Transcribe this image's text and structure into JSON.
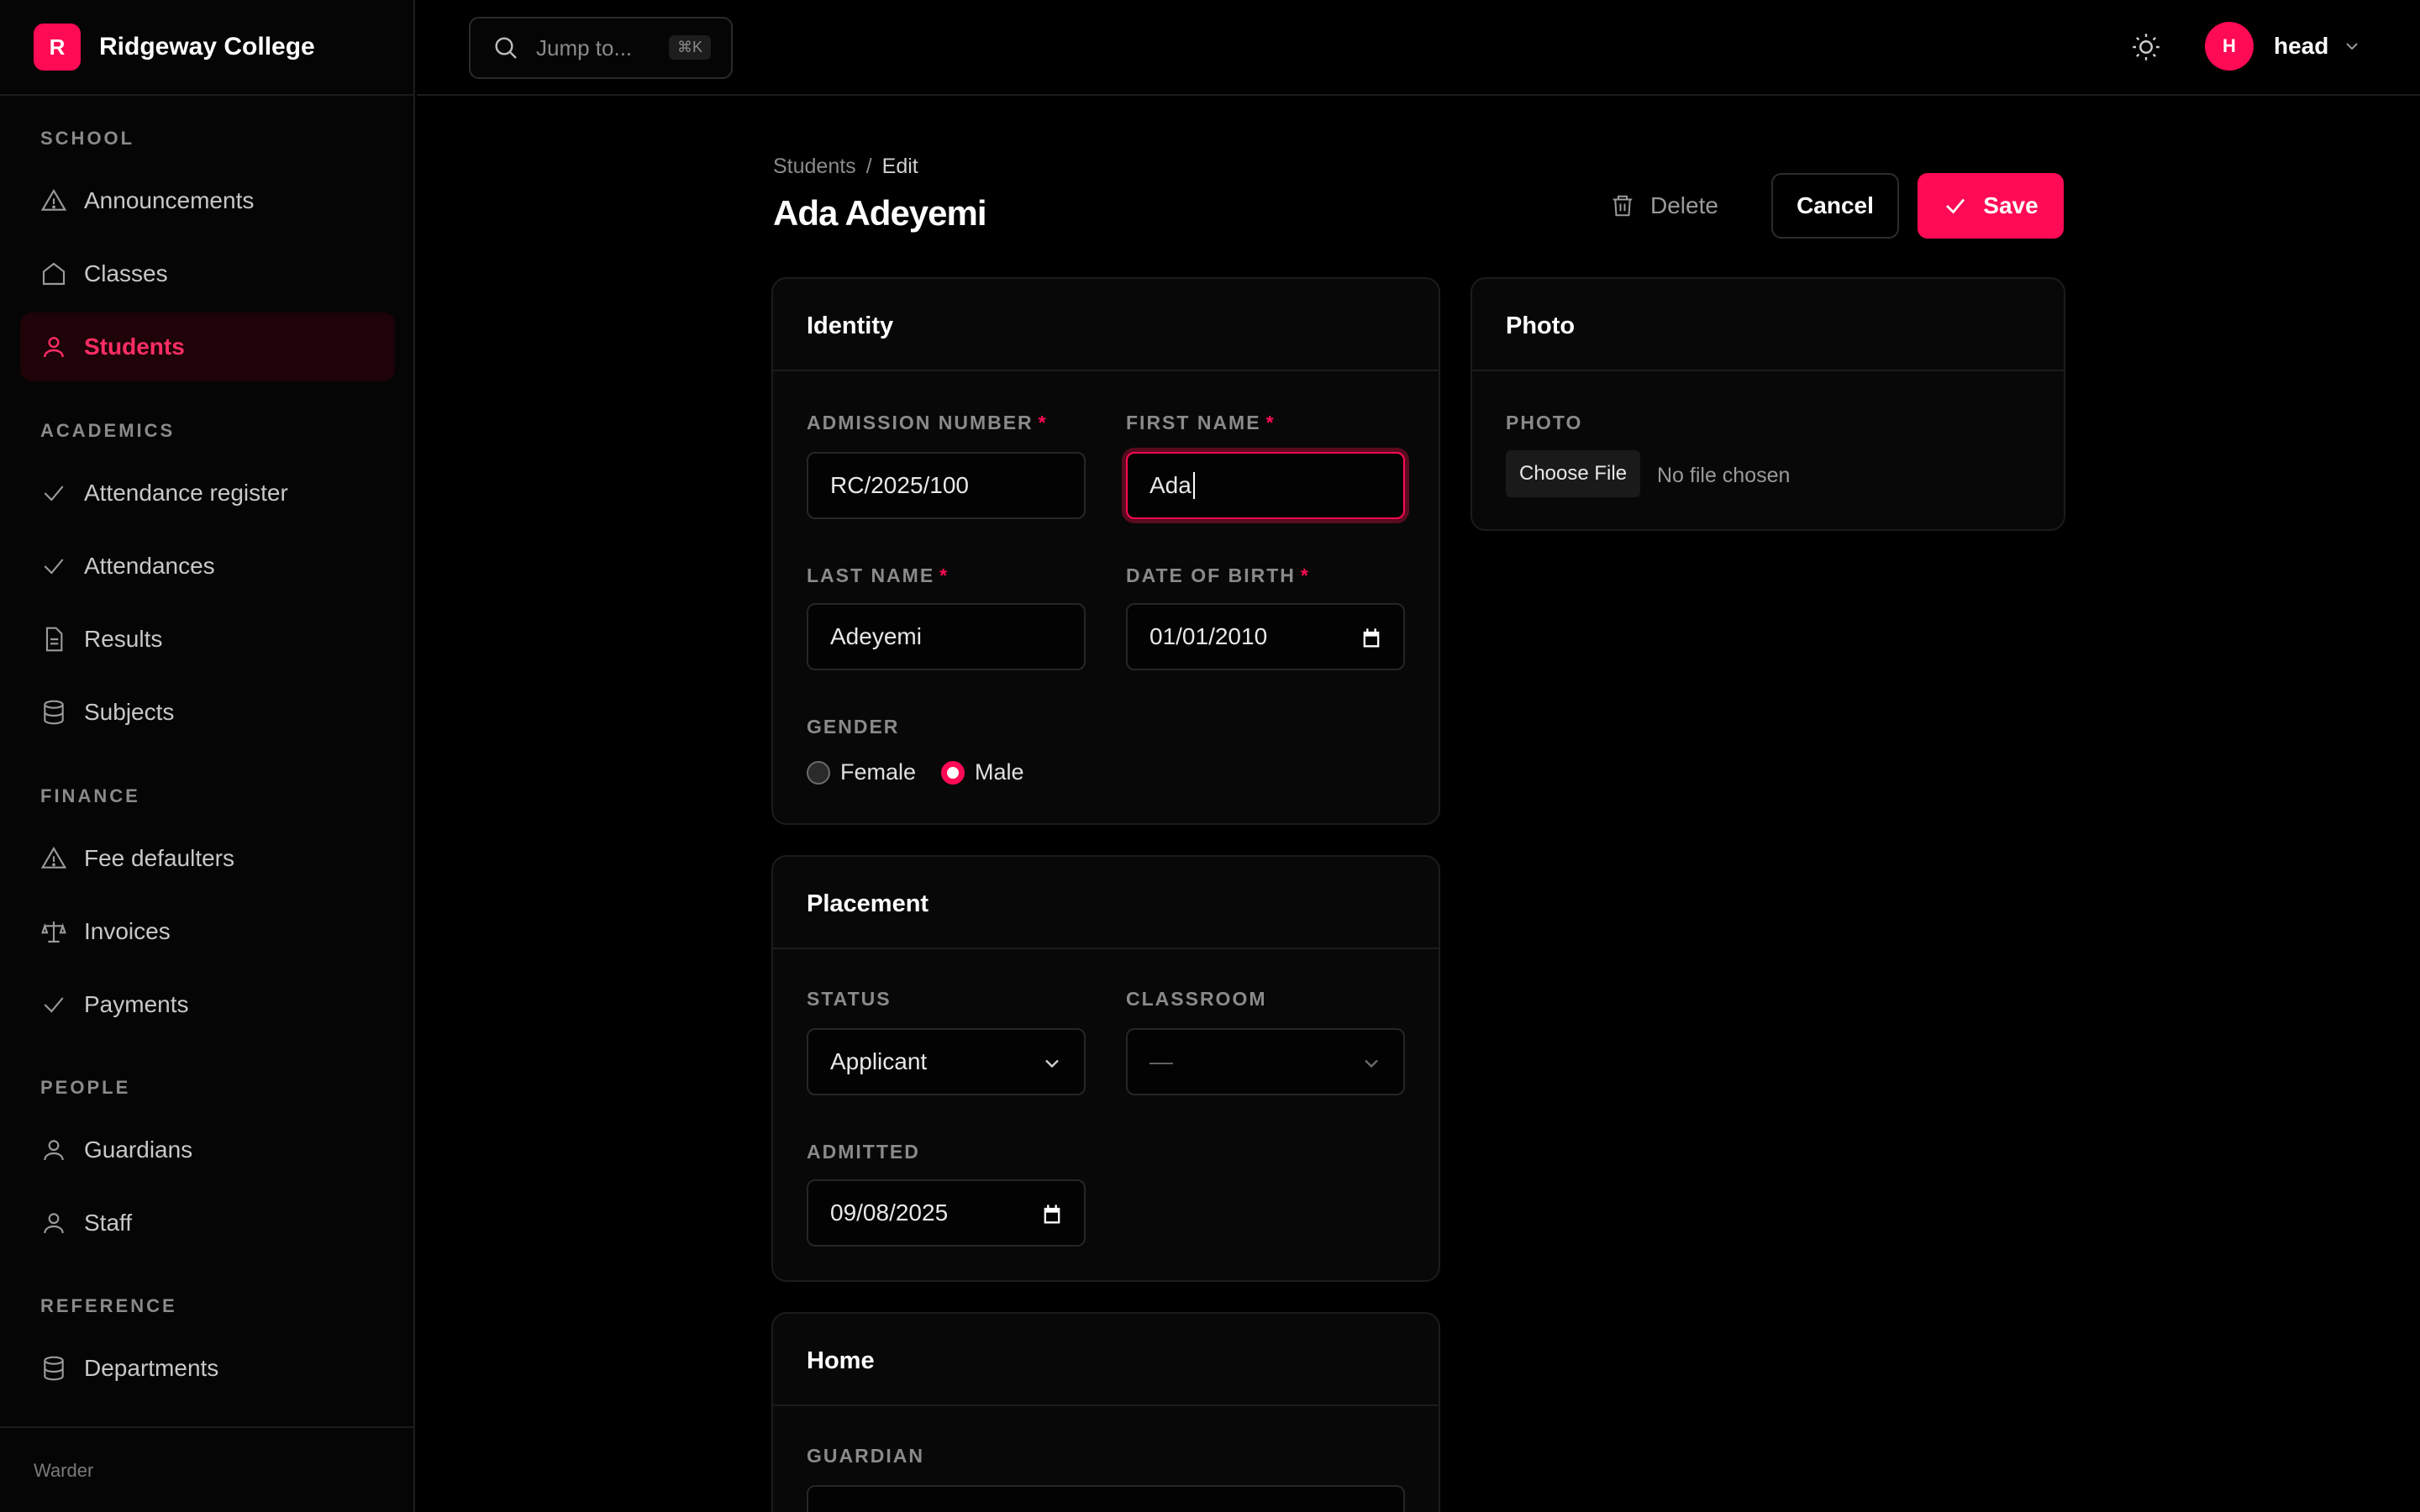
{
  "brand": {
    "logo_letter": "R",
    "name": "Ridgeway College"
  },
  "nav": {
    "sections": [
      {
        "label": "SCHOOL",
        "items": [
          {
            "label": "Announcements",
            "icon": "warning-icon"
          },
          {
            "label": "Classes",
            "icon": "home-icon"
          },
          {
            "label": "Students",
            "icon": "user-icon",
            "active": true
          }
        ]
      },
      {
        "label": "ACADEMICS",
        "items": [
          {
            "label": "Attendance register",
            "icon": "check-icon"
          },
          {
            "label": "Attendances",
            "icon": "check-icon"
          },
          {
            "label": "Results",
            "icon": "document-icon"
          },
          {
            "label": "Subjects",
            "icon": "database-icon"
          }
        ]
      },
      {
        "label": "FINANCE",
        "items": [
          {
            "label": "Fee defaulters",
            "icon": "warning-icon"
          },
          {
            "label": "Invoices",
            "icon": "scale-icon"
          },
          {
            "label": "Payments",
            "icon": "check-icon"
          }
        ]
      },
      {
        "label": "PEOPLE",
        "items": [
          {
            "label": "Guardians",
            "icon": "user-icon"
          },
          {
            "label": "Staff",
            "icon": "user-icon"
          }
        ]
      },
      {
        "label": "REFERENCE",
        "items": [
          {
            "label": "Departments",
            "icon": "database-icon"
          }
        ]
      }
    ],
    "footer": "Warder"
  },
  "topbar": {
    "search_placeholder": "Jump to...",
    "search_shortcut": "⌘K",
    "user_initial": "H",
    "user_name": "head"
  },
  "header": {
    "breadcrumb_parent": "Students",
    "breadcrumb_separator": "/",
    "breadcrumb_current": "Edit",
    "title": "Ada Adeyemi",
    "delete_label": "Delete",
    "cancel_label": "Cancel",
    "save_label": "Save"
  },
  "identity": {
    "title": "Identity",
    "admission_number_label": "ADMISSION NUMBER",
    "admission_number_value": "RC/2025/100",
    "first_name_label": "FIRST NAME",
    "first_name_value": "Ada",
    "last_name_label": "LAST NAME",
    "last_name_value": "Adeyemi",
    "dob_label": "DATE OF BIRTH",
    "dob_value": "01/01/2010",
    "gender_label": "GENDER",
    "gender_options": [
      "Female",
      "Male"
    ],
    "gender_selected": "Male",
    "required_mark": "*"
  },
  "placement": {
    "title": "Placement",
    "status_label": "STATUS",
    "status_value": "Applicant",
    "classroom_label": "CLASSROOM",
    "classroom_value": "—",
    "admitted_label": "ADMITTED",
    "admitted_value": "09/08/2025"
  },
  "home": {
    "title": "Home",
    "guardian_label": "GUARDIAN"
  },
  "photo": {
    "title": "Photo",
    "field_label": "PHOTO",
    "choose_label": "Choose File",
    "status": "No file chosen"
  },
  "colors": {
    "accent": "#ff0a54",
    "background": "#000000",
    "card": "#080808",
    "border": "#1c1c1c"
  }
}
